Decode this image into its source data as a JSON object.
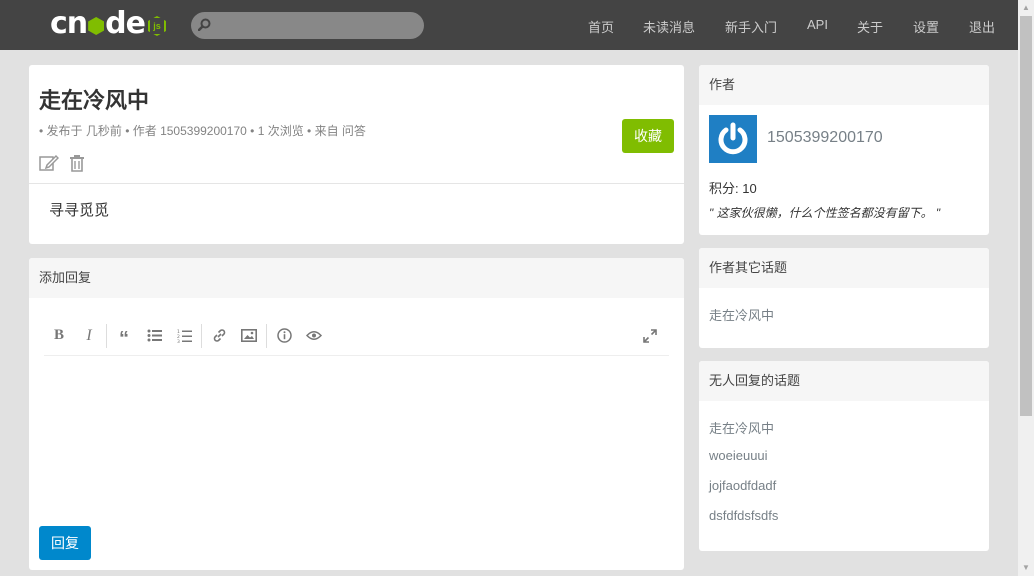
{
  "brand": {
    "logo_text": "cnode",
    "logo_badge": "js"
  },
  "search": {
    "value": "",
    "placeholder": ""
  },
  "nav": [
    {
      "label": "首页"
    },
    {
      "label": "未读消息"
    },
    {
      "label": "新手入门"
    },
    {
      "label": "API"
    },
    {
      "label": "关于"
    },
    {
      "label": "设置"
    },
    {
      "label": "退出"
    }
  ],
  "topic": {
    "title": "走在冷风中",
    "meta": "• 发布于 几秒前 • 作者 1505399200170 • 1 次浏览 • 来自 问答",
    "favorite_label": "收藏",
    "content": "寻寻觅觅",
    "icons": [
      "edit-icon",
      "trash-icon"
    ]
  },
  "reply": {
    "header": "添加回复",
    "submit_label": "回复",
    "toolbar_icons": [
      "bold-icon",
      "italic-icon",
      "quote-icon",
      "unordered-list-icon",
      "ordered-list-icon",
      "link-icon",
      "image-icon",
      "info-icon",
      "preview-icon",
      "fullscreen-icon"
    ]
  },
  "author": {
    "header": "作者",
    "name": "1505399200170",
    "score": "积分: 10",
    "signature": "\" 这家伙很懒，什么个性签名都没有留下。 \""
  },
  "other_topics": {
    "header": "作者其它话题",
    "items": [
      "走在冷风中"
    ]
  },
  "no_reply_topics": {
    "header": "无人回复的话题",
    "items": [
      "走在冷风中",
      "woeieuuui",
      "jojfaodfdadf",
      "dsfdfdsfsdfs"
    ]
  },
  "colors": {
    "navbar": "#444444",
    "accent_green": "#80bd01",
    "accent_blue": "#0088cc",
    "background": "#e1e1e1"
  }
}
